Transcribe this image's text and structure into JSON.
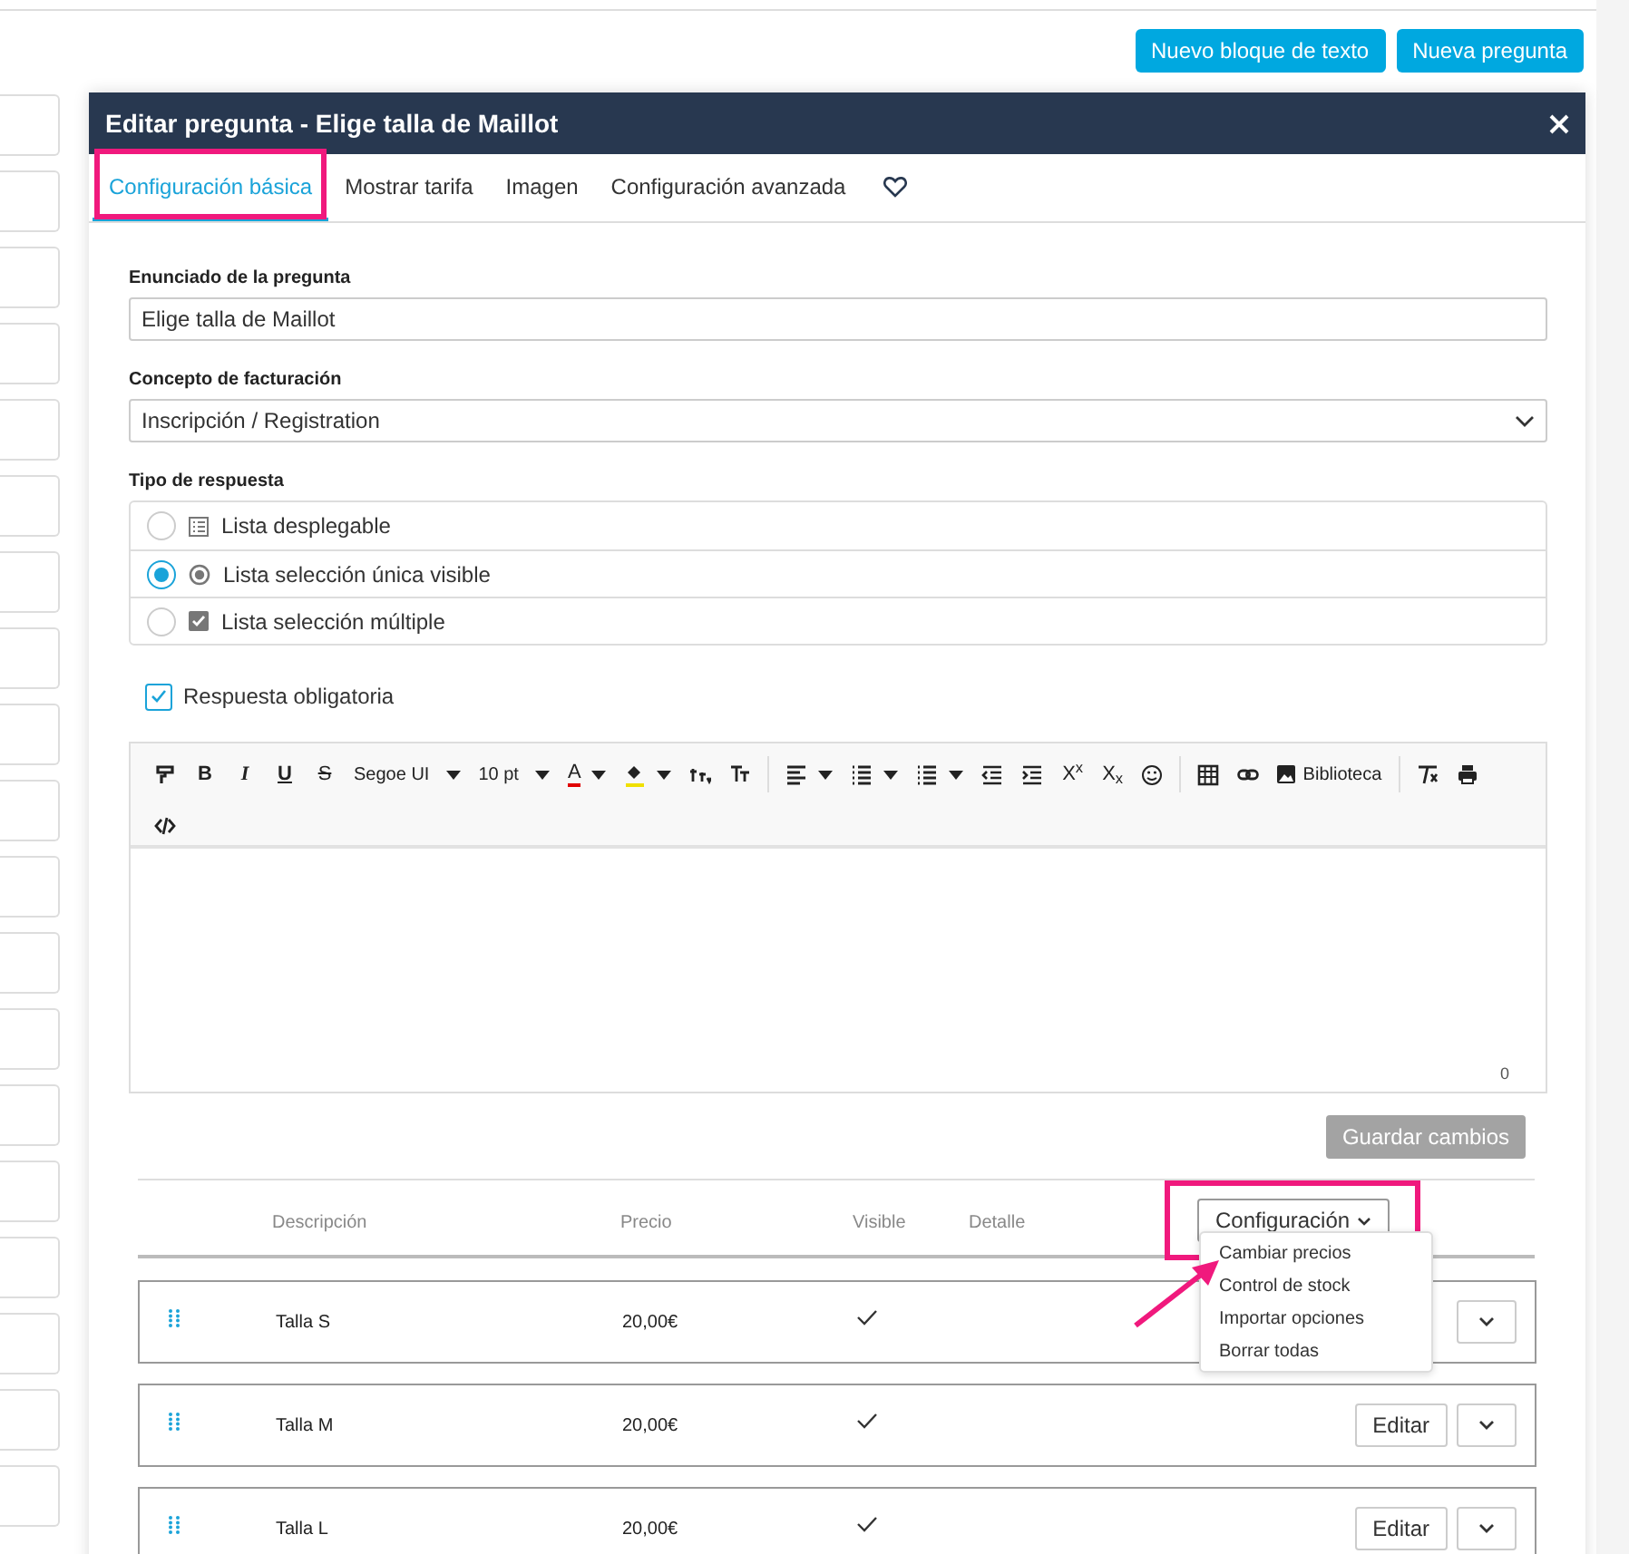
{
  "top_buttons": [
    {
      "label": "Nuevo bloque de texto"
    },
    {
      "label": "Nueva pregunta"
    }
  ],
  "dialog": {
    "title": "Editar pregunta - Elige talla de Maillot",
    "tabs": [
      {
        "label": "Configuración básica",
        "selected": true,
        "highlighted": true
      },
      {
        "label": "Mostrar tarifa",
        "selected": false
      },
      {
        "label": "Imagen",
        "selected": false
      },
      {
        "label": "Configuración avanzada",
        "selected": false
      },
      {
        "kind": "favorite",
        "selected": false
      }
    ],
    "question": {
      "label": "Enunciado de la pregunta",
      "value": "Elige talla de Maillot"
    },
    "billing": {
      "label": "Concepto de facturación",
      "value": "Inscripción / Registration"
    },
    "answer_type": {
      "label": "Tipo de respuesta",
      "options": [
        {
          "label": "Lista desplegable",
          "kind": "list",
          "selected": false
        },
        {
          "label": "Lista selección única visible",
          "kind": "radio",
          "selected": true
        },
        {
          "label": "Lista selección múltiple",
          "kind": "checkbox",
          "selected": false
        }
      ]
    },
    "required": {
      "label": "Respuesta obligatoria",
      "checked": true
    },
    "toolbar": [
      {
        "kind": "painter"
      },
      {
        "kind": "bold",
        "label": "B"
      },
      {
        "kind": "italic",
        "label": "I"
      },
      {
        "kind": "underline",
        "label": "U"
      },
      {
        "kind": "strike",
        "label": "S"
      },
      {
        "kind": "select",
        "label": "Segoe UI"
      },
      {
        "kind": "select",
        "label": "10 pt"
      },
      {
        "kind": "color",
        "label": "A",
        "color": "#e00000"
      },
      {
        "kind": "fill",
        "color": "#f0e000"
      },
      {
        "kind": "line-height"
      },
      {
        "kind": "text-case"
      },
      {
        "kind": "separator"
      },
      {
        "kind": "align"
      },
      {
        "kind": "list"
      },
      {
        "kind": "list"
      },
      {
        "kind": "outdent"
      },
      {
        "kind": "indent"
      },
      {
        "kind": "superscript",
        "label": "X$^{x}$"
      },
      {
        "kind": "subscript",
        "label": "X$_{x}$"
      },
      {
        "kind": "emoji"
      },
      {
        "kind": "separator"
      },
      {
        "kind": "table"
      },
      {
        "kind": "link"
      },
      {
        "kind": "image",
        "label": "Biblioteca"
      },
      {
        "kind": "separator"
      },
      {
        "kind": "clear"
      },
      {
        "kind": "print"
      },
      {
        "kind": "code"
      }
    ],
    "char_count": "0",
    "save_button": {
      "label": "Guardar cambios",
      "disabled": true
    },
    "table": {
      "columns": [
        "Descripción",
        "Precio",
        "Visible",
        "Detalle"
      ],
      "config_button": {
        "label": "Configuración",
        "highlighted": true
      },
      "menu": [
        "Cambiar precios",
        "Control de stock",
        "Importar opciones",
        "Borrar todas"
      ],
      "rows": [
        {
          "description": "Talla S",
          "price": "20,00€",
          "visible": true
        },
        {
          "description": "Talla M",
          "price": "20,00€",
          "visible": true,
          "edit": "Editar"
        },
        {
          "description": "Talla L",
          "price": "20,00€",
          "visible": true,
          "edit": "Editar"
        }
      ]
    }
  }
}
